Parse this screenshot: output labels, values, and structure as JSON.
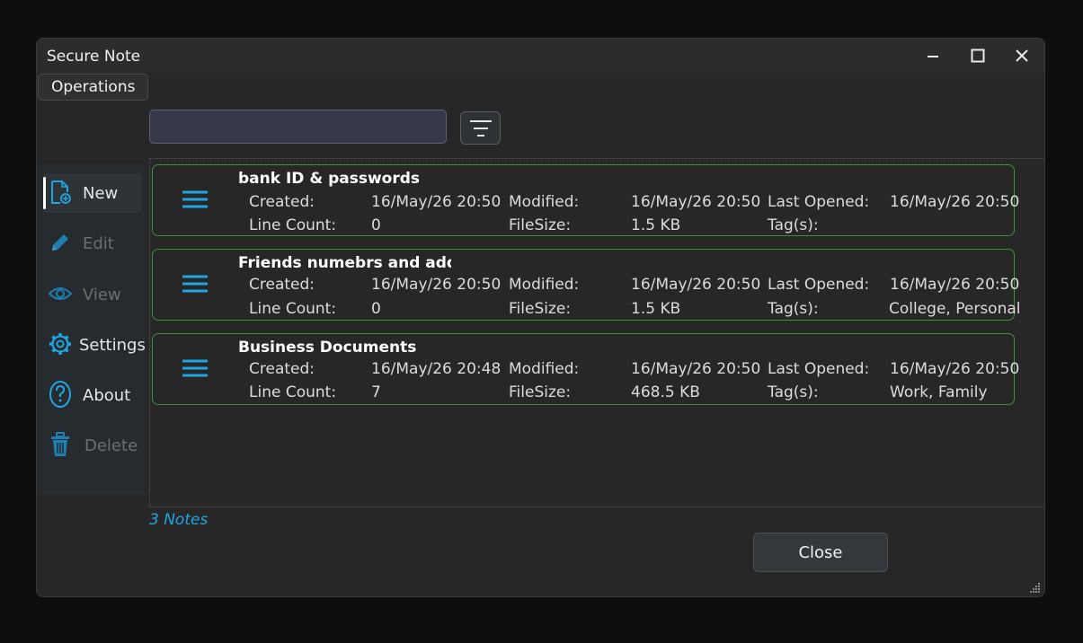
{
  "window": {
    "title": "Secure Note"
  },
  "menu": {
    "operations_label": "Operations"
  },
  "search": {
    "value": "",
    "placeholder": ""
  },
  "sidebar": {
    "items": [
      {
        "label": "New",
        "icon": "new-note-icon",
        "enabled": true,
        "active": true
      },
      {
        "label": "Edit",
        "icon": "pencil-icon",
        "enabled": false,
        "active": false
      },
      {
        "label": "View",
        "icon": "eye-icon",
        "enabled": false,
        "active": false
      },
      {
        "label": "Settings",
        "icon": "gear-icon",
        "enabled": true,
        "active": false
      },
      {
        "label": "About",
        "icon": "help-icon",
        "enabled": true,
        "active": false
      },
      {
        "label": "Delete",
        "icon": "trash-icon",
        "enabled": false,
        "active": false
      }
    ]
  },
  "fields": {
    "created": "Created:",
    "modified": "Modified:",
    "last_opened": "Last Opened:",
    "line_count": "Line Count:",
    "file_size": "FileSize:",
    "tags": "Tag(s):"
  },
  "notes": [
    {
      "title": "bank ID & passwords",
      "created": "16/May/26 20:50",
      "modified": "16/May/26 20:50",
      "last_opened": "16/May/26 20:50",
      "line_count": "0",
      "file_size": "1.5 KB",
      "tags": ""
    },
    {
      "title": "Friends numebrs and address",
      "created": "16/May/26 20:50",
      "modified": "16/May/26 20:50",
      "last_opened": "16/May/26 20:50",
      "line_count": "0",
      "file_size": "1.5 KB",
      "tags": "College, Personal"
    },
    {
      "title": "Business Documents",
      "created": "16/May/26 20:48",
      "modified": "16/May/26 20:50",
      "last_opened": "16/May/26 20:50",
      "line_count": "7",
      "file_size": "468.5 KB",
      "tags": "Work, Family"
    }
  ],
  "status": {
    "count_text": "3 Notes"
  },
  "footer": {
    "close_label": "Close"
  },
  "colors": {
    "accent": "#1fa6e0",
    "card_border": "#3f8f3f",
    "background": "#272727"
  }
}
